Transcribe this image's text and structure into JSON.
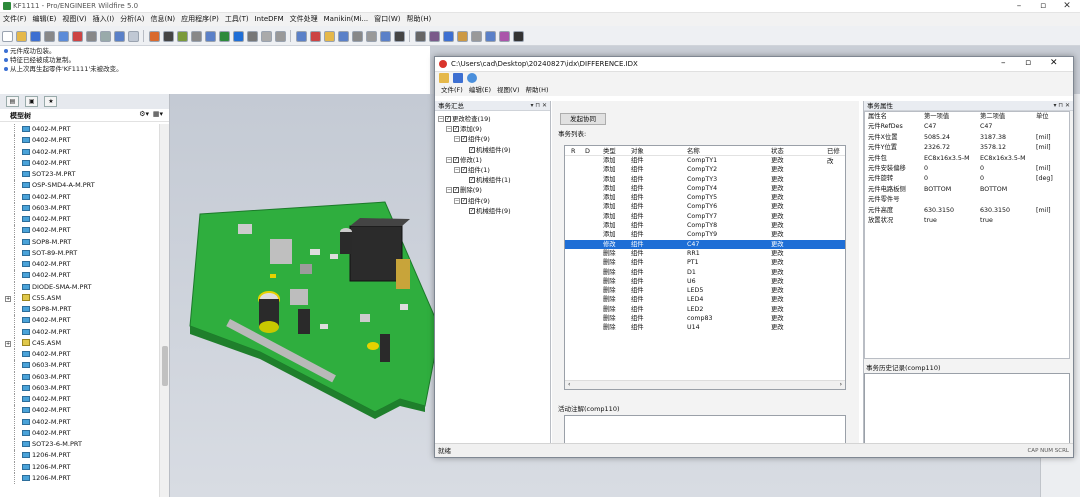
{
  "app": {
    "title": "KF1111 - Pro/ENGINEER Wildfire 5.0"
  },
  "menubar": [
    "文件(F)",
    "编辑(E)",
    "视图(V)",
    "插入(I)",
    "分析(A)",
    "信息(N)",
    "应用程序(P)",
    "工具(T)",
    "InteDFM",
    "文件处理",
    "Manikin(Mi...",
    "窗口(W)",
    "帮助(H)"
  ],
  "messages": [
    "元件成功包装。",
    "特征已经被成功复制。",
    "从上次再生起零件'KF1111'未被改变。"
  ],
  "model_tree": {
    "header": "模型树",
    "items": [
      {
        "label": "0402-M.PRT",
        "type": "part"
      },
      {
        "label": "0402-M.PRT",
        "type": "part"
      },
      {
        "label": "0402-M.PRT",
        "type": "part"
      },
      {
        "label": "0402-M.PRT",
        "type": "part"
      },
      {
        "label": "SOT23-M.PRT",
        "type": "part"
      },
      {
        "label": "OSP-SMD4-A-M.PRT",
        "type": "part"
      },
      {
        "label": "0402-M.PRT",
        "type": "part"
      },
      {
        "label": "0603-M.PRT",
        "type": "part"
      },
      {
        "label": "0402-M.PRT",
        "type": "part"
      },
      {
        "label": "0402-M.PRT",
        "type": "part"
      },
      {
        "label": "SOP8-M.PRT",
        "type": "part"
      },
      {
        "label": "SOT-89-M.PRT",
        "type": "part"
      },
      {
        "label": "0402-M.PRT",
        "type": "part"
      },
      {
        "label": "0402-M.PRT",
        "type": "part"
      },
      {
        "label": "DIODE-SMA-M.PRT",
        "type": "part"
      },
      {
        "label": "C55.ASM",
        "type": "asm"
      },
      {
        "label": "SOP8-M.PRT",
        "type": "part"
      },
      {
        "label": "0402-M.PRT",
        "type": "part"
      },
      {
        "label": "0402-M.PRT",
        "type": "part"
      },
      {
        "label": "C45.ASM",
        "type": "asm"
      },
      {
        "label": "0402-M.PRT",
        "type": "part"
      },
      {
        "label": "0603-M.PRT",
        "type": "part"
      },
      {
        "label": "0603-M.PRT",
        "type": "part"
      },
      {
        "label": "0603-M.PRT",
        "type": "part"
      },
      {
        "label": "0402-M.PRT",
        "type": "part"
      },
      {
        "label": "0402-M.PRT",
        "type": "part"
      },
      {
        "label": "0402-M.PRT",
        "type": "part"
      },
      {
        "label": "0402-M.PRT",
        "type": "part"
      },
      {
        "label": "SOT23-6-M.PRT",
        "type": "part"
      },
      {
        "label": "1206-M.PRT",
        "type": "part"
      },
      {
        "label": "1206-M.PRT",
        "type": "part"
      },
      {
        "label": "1206-M.PRT",
        "type": "part"
      }
    ]
  },
  "idx": {
    "title": "C:\\Users\\cad\\Desktop\\20240827\\idx\\DIFFERENCE.IDX",
    "menu": [
      "文件(F)",
      "编辑(E)",
      "视图(V)",
      "帮助(H)"
    ],
    "summary_header": "事务汇总",
    "tree": [
      {
        "indent": 0,
        "label": "更改检查(19)",
        "exp": "⊟"
      },
      {
        "indent": 1,
        "label": "添加(9)",
        "exp": "⊟"
      },
      {
        "indent": 2,
        "label": "组件(9)",
        "exp": "⊟"
      },
      {
        "indent": 3,
        "label": "机械组件(9)",
        "exp": ""
      },
      {
        "indent": 1,
        "label": "修改(1)",
        "exp": "⊟"
      },
      {
        "indent": 2,
        "label": "组件(1)",
        "exp": "⊟"
      },
      {
        "indent": 3,
        "label": "机械组件(1)",
        "exp": ""
      },
      {
        "indent": 1,
        "label": "删除(9)",
        "exp": "⊟"
      },
      {
        "indent": 2,
        "label": "组件(9)",
        "exp": "⊟"
      },
      {
        "indent": 3,
        "label": "机械组件(9)",
        "exp": ""
      }
    ],
    "compare_button": "发起协同",
    "list_label": "事务列表:",
    "columns": [
      "R",
      "D",
      "类型",
      "对象",
      "名称",
      "状态",
      "已修改"
    ],
    "rows": [
      [
        "添加",
        "组件",
        "CompTY1",
        "更改"
      ],
      [
        "添加",
        "组件",
        "CompTY2",
        "更改"
      ],
      [
        "添加",
        "组件",
        "CompTY3",
        "更改"
      ],
      [
        "添加",
        "组件",
        "CompTY4",
        "更改"
      ],
      [
        "添加",
        "组件",
        "CompTY5",
        "更改"
      ],
      [
        "添加",
        "组件",
        "CompTY6",
        "更改"
      ],
      [
        "添加",
        "组件",
        "CompTY7",
        "更改"
      ],
      [
        "添加",
        "组件",
        "CompTY8",
        "更改"
      ],
      [
        "添加",
        "组件",
        "CompTY9",
        "更改"
      ],
      [
        "修改",
        "组件",
        "C47",
        "更改"
      ],
      [
        "删除",
        "组件",
        "RR1",
        "更改"
      ],
      [
        "删除",
        "组件",
        "PT1",
        "更改"
      ],
      [
        "删除",
        "组件",
        "D1",
        "更改"
      ],
      [
        "删除",
        "组件",
        "U6",
        "更改"
      ],
      [
        "删除",
        "组件",
        "LED5",
        "更改"
      ],
      [
        "删除",
        "组件",
        "LED4",
        "更改"
      ],
      [
        "删除",
        "组件",
        "LED2",
        "更改"
      ],
      [
        "删除",
        "组件",
        "comp83",
        "更改"
      ],
      [
        "删除",
        "组件",
        "U14",
        "更改"
      ]
    ],
    "selected_row": 9,
    "note_label": "活动注解(comp110)",
    "props_header": "事务属性",
    "prop_columns": [
      "属性名",
      "第一项值",
      "第二项值",
      "单位"
    ],
    "props": [
      [
        "元件RefDes",
        "C47",
        "C47",
        ""
      ],
      [
        "元件X位置",
        "5085.24",
        "3187.38",
        "[mil]"
      ],
      [
        "元件Y位置",
        "2326.72",
        "3578.12",
        "[mil]"
      ],
      [
        "元件包",
        "EC8x16x3.5-M",
        "EC8x16x3.5-M",
        ""
      ],
      [
        "元件安装偏移",
        "0",
        "0",
        "[mil]"
      ],
      [
        "元件旋转",
        "0",
        "0",
        "[deg]"
      ],
      [
        "元件电路板侧",
        "BOTTOM",
        "BOTTOM",
        ""
      ],
      [
        "元件零件号",
        "",
        "",
        ""
      ],
      [
        "元件高度",
        "630.3150",
        "630.3150",
        "[mil]"
      ],
      [
        "放置状况",
        "true",
        "true",
        ""
      ]
    ],
    "history_label": "事务历史记录(comp110)",
    "status": "就绪",
    "status_right": "CAP NUM SCRL"
  },
  "colors": {
    "accent": "#1e6ed6",
    "board": "#2fae3e"
  }
}
